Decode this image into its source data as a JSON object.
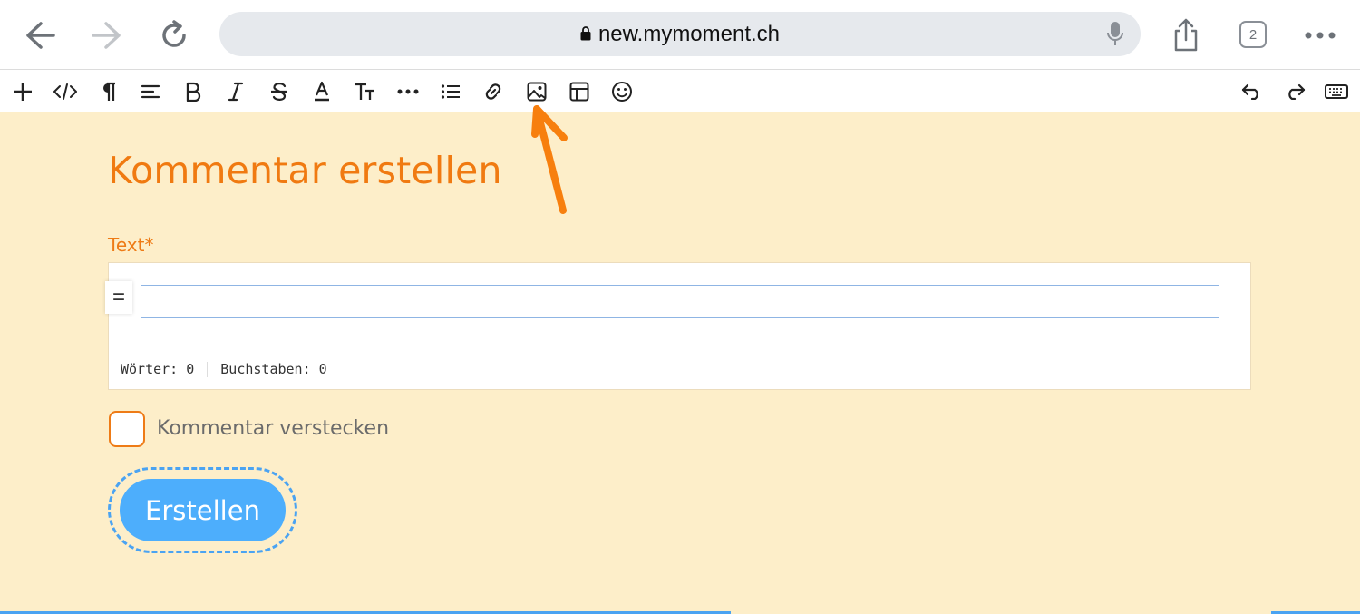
{
  "browser": {
    "url": "new.mymoment.ch",
    "tab_count": "2",
    "icons": [
      "back-icon",
      "forward-icon",
      "reload-icon",
      "lock-icon",
      "microphone-icon",
      "share-icon",
      "tabs-icon",
      "more-icon"
    ]
  },
  "toolbar": {
    "icons": [
      "add-icon",
      "code-icon",
      "paragraph-icon",
      "align-icon",
      "bold-icon",
      "italic-icon",
      "strikethrough-icon",
      "text-color-icon",
      "text-size-icon",
      "more-horizontal-icon",
      "list-icon",
      "link-icon",
      "image-icon",
      "table-icon",
      "emoji-icon",
      "undo-icon",
      "redo-icon",
      "keyboard-icon"
    ]
  },
  "form": {
    "title": "Kommentar erstellen",
    "text_label": "Text*",
    "word_count": "Wörter: 0",
    "char_count": "Buchstaben: 0",
    "hide_label": "Kommentar verstecken",
    "submit_label": "Erstellen"
  },
  "colors": {
    "page_bg": "#fdeec9",
    "accent_orange": "#f07a11",
    "button_blue": "#4daefc"
  }
}
